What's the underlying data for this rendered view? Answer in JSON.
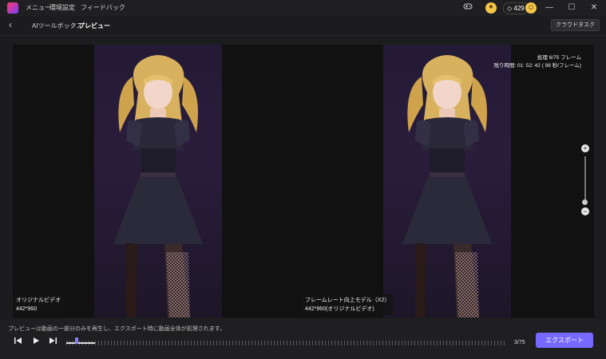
{
  "titlebar": {
    "menu": [
      "メニュー",
      "環境設定",
      "フィードバック"
    ],
    "gem_count": "429",
    "icons": [
      "app-logo-icon",
      "gamepad-icon",
      "gift-icon",
      "gem-icon",
      "avatar-icon",
      "minimize-icon",
      "maximize-icon",
      "close-icon"
    ]
  },
  "nav": {
    "crumb_parent": "AIツールボックス",
    "separator": ">",
    "crumb_current": "プレビュー",
    "cloud_button": "クラウドタスク"
  },
  "preview": {
    "left_label": "オリジナルビデオ",
    "left_resolution": "442*960",
    "right_label": "フレームレート向上モデル（X2）",
    "right_resolution": "442*960(オリジナルビデオ)",
    "progress_line": "処理 6/75 フレーム",
    "remaining_line": "残り時間: 01: 52: 42 ( 98 秒/フレーム)",
    "zoom_in": "+",
    "zoom_out": "−"
  },
  "bottom": {
    "note": "プレビューは動画の一部分のみを再生し、エクスポート時に動画全体が処理されます。",
    "frame_count": "3/75",
    "export_button": "エクスポート"
  },
  "colors": {
    "accent": "#7669ff",
    "background": "#1c1c1e",
    "stage": "#111111"
  }
}
